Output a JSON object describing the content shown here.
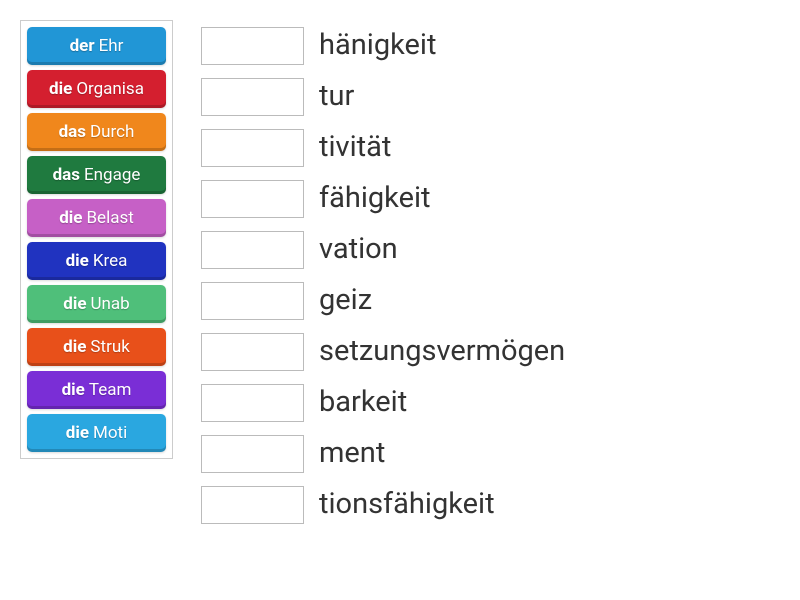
{
  "tiles": [
    {
      "article": "der",
      "stem": "Ehr",
      "color": "#2196d6"
    },
    {
      "article": "die",
      "stem": "Organisa",
      "color": "#d41f2f"
    },
    {
      "article": "das",
      "stem": "Durch",
      "color": "#f0871c"
    },
    {
      "article": "das",
      "stem": "Engage",
      "color": "#1f7a3f"
    },
    {
      "article": "die",
      "stem": "Belast",
      "color": "#c660c6"
    },
    {
      "article": "die",
      "stem": "Krea",
      "color": "#2033c0"
    },
    {
      "article": "die",
      "stem": "Unab",
      "color": "#4fbf7a"
    },
    {
      "article": "die",
      "stem": "Struk",
      "color": "#e8501a"
    },
    {
      "article": "die",
      "stem": "Team",
      "color": "#7a2ed6"
    },
    {
      "article": "die",
      "stem": "Moti",
      "color": "#2aa7e0"
    }
  ],
  "rows": [
    {
      "suffix": "hänigkeit"
    },
    {
      "suffix": "tur"
    },
    {
      "suffix": "tivität"
    },
    {
      "suffix": "fähigkeit"
    },
    {
      "suffix": "vation"
    },
    {
      "suffix": "geiz"
    },
    {
      "suffix": "setzungsvermögen"
    },
    {
      "suffix": "barkeit"
    },
    {
      "suffix": "ment"
    },
    {
      "suffix": "tionsfähigkeit"
    }
  ]
}
